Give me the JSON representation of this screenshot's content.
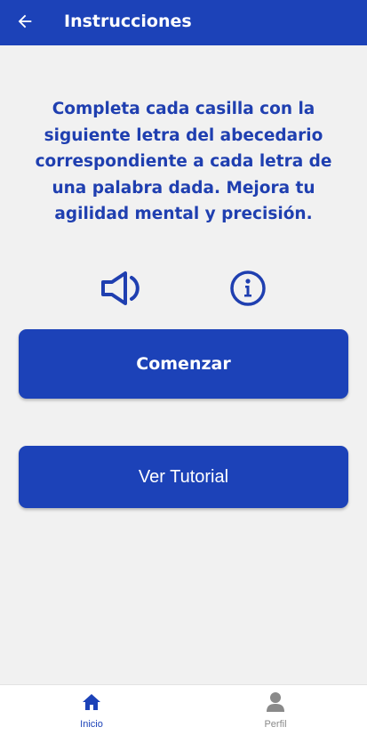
{
  "header": {
    "title": "Instrucciones",
    "back_icon": "arrow-left-icon"
  },
  "main": {
    "instructions": "Completa cada casilla con la siguiente letra del abecedario correspondiente a cada letra de una palabra dada. Mejora tu agilidad mental y precisión.",
    "speaker_icon": "speaker-icon",
    "info_icon": "info-icon",
    "start_label": "Comenzar",
    "tutorial_label": "Ver Tutorial"
  },
  "bottom_nav": {
    "items": [
      {
        "label": "Inicio",
        "icon": "home-icon",
        "active": true
      },
      {
        "label": "Perfil",
        "icon": "person-icon",
        "active": false
      }
    ]
  },
  "colors": {
    "primary": "#1c42b8",
    "text_primary": "#1f3fb0",
    "background": "#f1f1f1",
    "inactive": "#8a8a8a"
  }
}
